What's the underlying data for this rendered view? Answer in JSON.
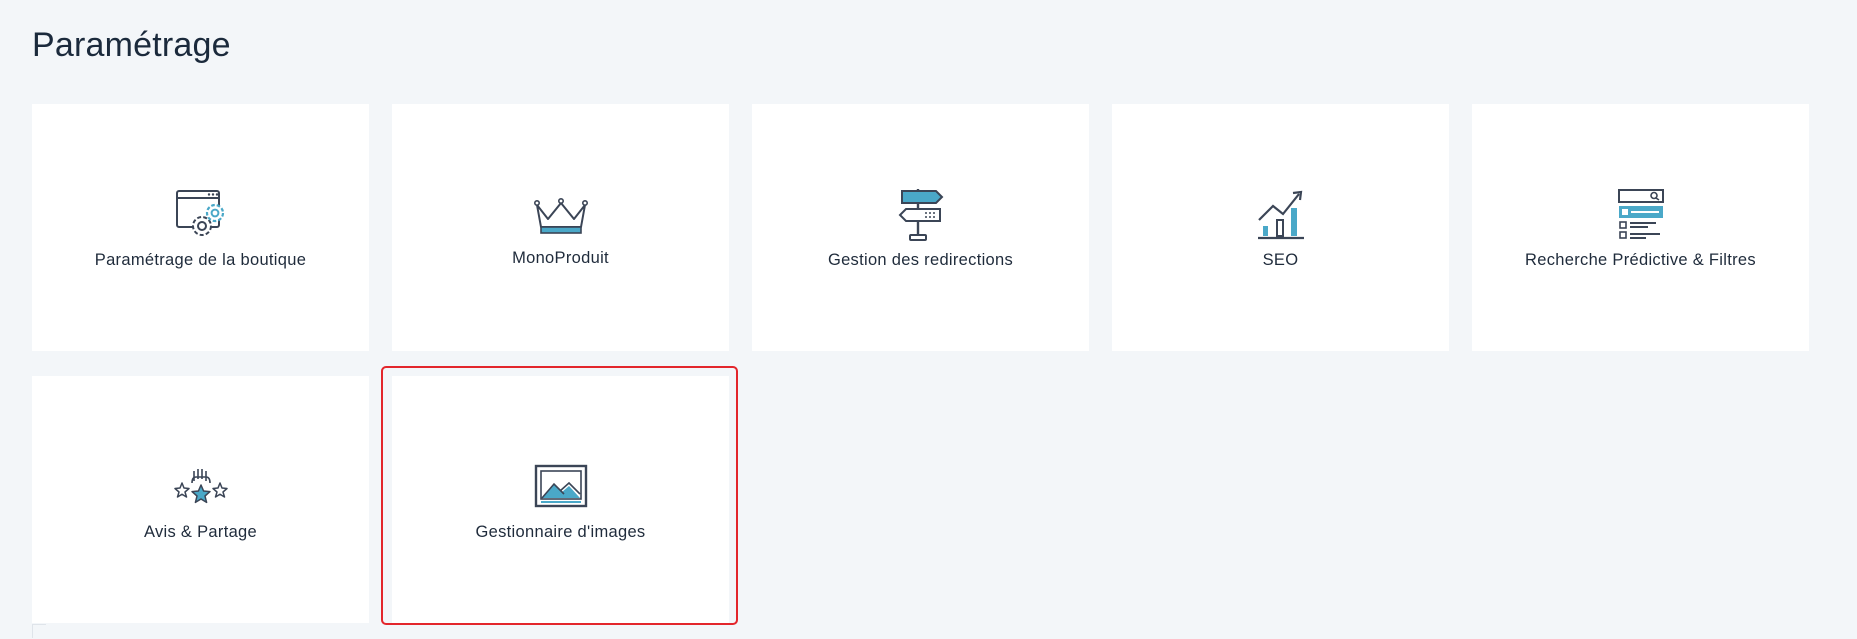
{
  "page": {
    "title": "Paramétrage"
  },
  "tiles": [
    {
      "label": "Paramétrage de la boutique",
      "icon": "shop-settings-icon"
    },
    {
      "label": "MonoProduit",
      "icon": "crown-icon"
    },
    {
      "label": "Gestion des redirections",
      "icon": "signpost-icon"
    },
    {
      "label": "SEO",
      "icon": "growth-chart-icon"
    },
    {
      "label": "Recherche Prédictive & Filtres",
      "icon": "search-filter-icon"
    },
    {
      "label": "Avis & Partage",
      "icon": "stars-rating-icon"
    },
    {
      "label": "Gestionnaire d'images",
      "icon": "image-icon"
    }
  ],
  "colors": {
    "background": "#f3f6f9",
    "tile": "#ffffff",
    "accent_blue": "#4aa8c8",
    "icon_dark": "#3b4556",
    "selection": "#e3262c"
  },
  "selected_tile": "Gestionnaire d'images"
}
